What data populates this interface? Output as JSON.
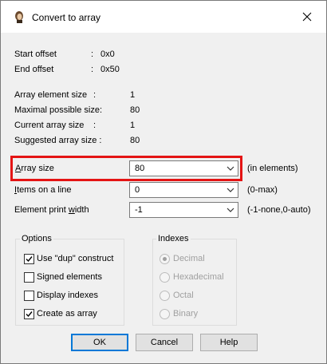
{
  "window": {
    "title": "Convert to array",
    "icon": "app-icon",
    "close_glyph": "✕"
  },
  "info": {
    "start_offset_label": "Start offset",
    "start_offset_sep": ":",
    "start_offset_value": "0x0",
    "end_offset_label": "End offset",
    "end_offset_sep": ":",
    "end_offset_value": "0x50",
    "array_element_size_label": "Array element size",
    "array_element_size_sep": ":",
    "array_element_size_value": "1",
    "maximal_possible_size_label": "Maximal possible size:",
    "maximal_possible_size_value": "80",
    "current_array_size_label": "Current array size",
    "current_array_size_sep": ":",
    "current_array_size_value": "1",
    "suggested_array_size_label": "Suggested array size :",
    "suggested_array_size_value": "80"
  },
  "fields": {
    "array_size": {
      "label_ul": "A",
      "label_rest": "rray size",
      "value": "80",
      "hint": "(in elements)"
    },
    "items_on_line": {
      "label_ul": "I",
      "label_rest": "tems on a line",
      "value": "0",
      "hint": "(0-max)"
    },
    "element_print_width": {
      "label_pre": "Element print ",
      "label_ul": "w",
      "label_rest": "idth",
      "value": "-1",
      "hint": "(-1-none,0-auto)"
    }
  },
  "options": {
    "title": "Options",
    "items": [
      {
        "label": "Use \"dup\" construct",
        "checked": true
      },
      {
        "label": "Signed elements",
        "checked": false
      },
      {
        "label": "Display indexes",
        "checked": false
      },
      {
        "label": "Create as array",
        "checked": true
      }
    ]
  },
  "indexes": {
    "title": "Indexes",
    "items": [
      {
        "label": "Decimal",
        "selected": true
      },
      {
        "label": "Hexadecimal",
        "selected": false
      },
      {
        "label": "Octal",
        "selected": false
      },
      {
        "label": "Binary",
        "selected": false
      }
    ],
    "enabled": false
  },
  "buttons": {
    "ok": "OK",
    "cancel": "Cancel",
    "help": "Help"
  },
  "colors": {
    "highlight": "#e41414",
    "default_button_border": "#0078d7",
    "disabled_text": "#a0a0a0"
  }
}
